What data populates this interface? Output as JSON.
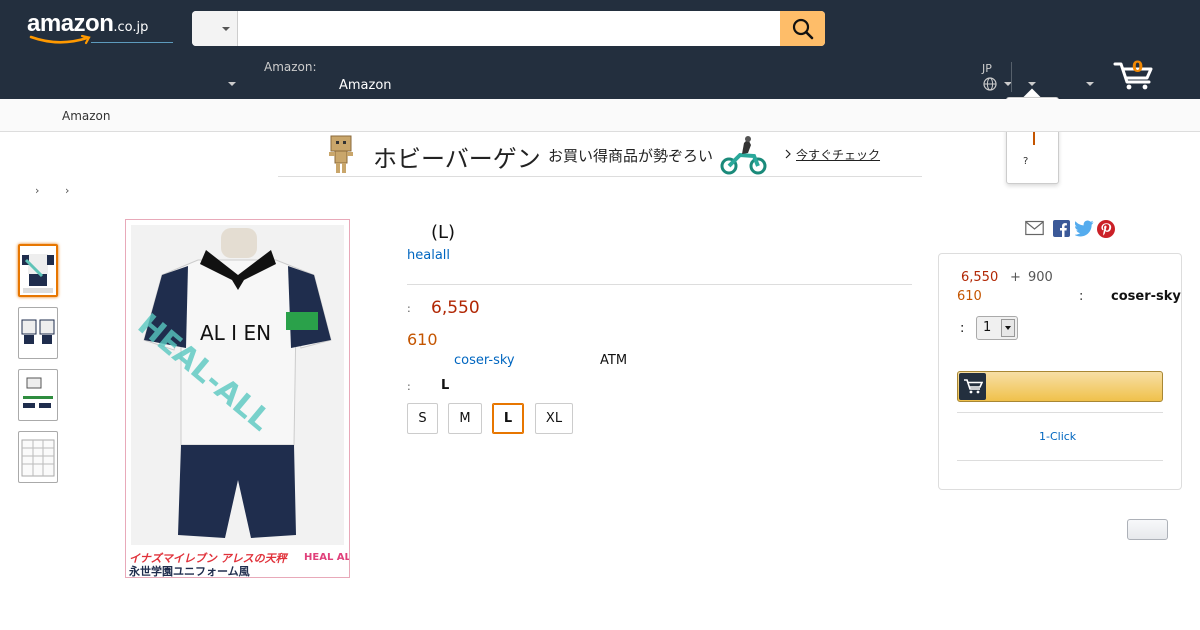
{
  "header": {
    "logo_text": "amazon",
    "logo_tld": ".co.jp",
    "search": {
      "category": "",
      "placeholder": ""
    },
    "delivery_label": "Amazon:",
    "delivery_value": "Amazon",
    "language": "JP",
    "cart_count": "0"
  },
  "flyout": {
    "text": "?"
  },
  "subnav": {
    "label": "Amazon"
  },
  "banner": {
    "title": "ホビーバーゲン",
    "subtitle": "お買い得商品が勢ぞろい",
    "cta": "今すぐチェック"
  },
  "breadcrumb": [
    "›",
    "›"
  ],
  "gallery": {
    "image_caption_1": "イナズマイレブン アレスの天秤",
    "image_caption_2": "永世学園ユニフォーム風",
    "shirt_text": "AL I EN",
    "watermark": "HEAL-ALL",
    "logo": "HEAL ALL"
  },
  "product": {
    "title": "(L)",
    "brand": "healall",
    "price_label": ":",
    "price": "6,550",
    "points": "610",
    "seller": "coser-sky",
    "payment": "ATM",
    "size_label": ":",
    "size_selected": "L",
    "sizes": [
      "S",
      "M",
      "L",
      "XL"
    ]
  },
  "buybox": {
    "price": "6,550",
    "plus": "+",
    "shipping": "900",
    "points": "610",
    "seller_colon": ":",
    "seller": "coser-sky",
    "qty_label": ":",
    "qty": "1",
    "one_click": "1-Click"
  },
  "colors": {
    "nav_bg": "#232f3e",
    "search_button": "#febd69",
    "price": "#b12704",
    "points": "#c45500",
    "link": "#0066c0",
    "selected_border": "#e77600"
  }
}
